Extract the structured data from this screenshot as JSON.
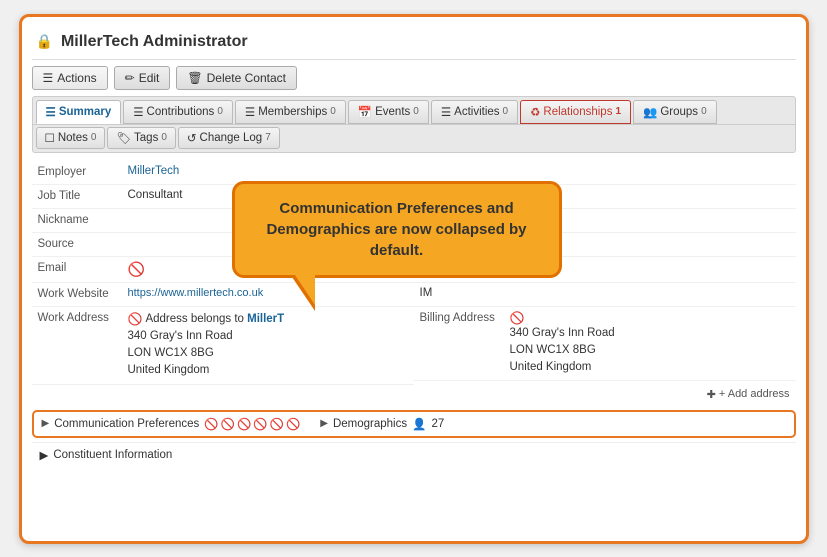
{
  "title": "MillerTech Administrator",
  "toolbar": {
    "actions_label": "Actions",
    "edit_label": "Edit",
    "delete_label": "Delete Contact"
  },
  "tabs_row1": [
    {
      "label": "Summary",
      "badge": "",
      "active": true,
      "icon": "☰"
    },
    {
      "label": "Contributions",
      "badge": "0",
      "active": false,
      "icon": "☰"
    },
    {
      "label": "Memberships",
      "badge": "0",
      "active": false,
      "icon": "☰"
    },
    {
      "label": "Events",
      "badge": "0",
      "active": false,
      "icon": "📅"
    },
    {
      "label": "Activities",
      "badge": "0",
      "active": false,
      "icon": "☰"
    },
    {
      "label": "Relationships",
      "badge": "1",
      "active": false,
      "icon": "♻",
      "highlighted": true
    },
    {
      "label": "Groups",
      "badge": "0",
      "active": false,
      "icon": "👥"
    }
  ],
  "tabs_row2": [
    {
      "label": "Notes",
      "badge": "0",
      "active": false,
      "icon": "☐"
    },
    {
      "label": "Tags",
      "badge": "0",
      "active": false,
      "icon": "🏷"
    },
    {
      "label": "Change Log",
      "badge": "7",
      "active": false,
      "icon": "↺"
    }
  ],
  "fields": {
    "left": [
      {
        "label": "Employer",
        "value": "MillerTech",
        "type": "link"
      },
      {
        "label": "Job Title",
        "value": "Consultant",
        "type": "text"
      },
      {
        "label": "Nickname",
        "value": "",
        "type": "text"
      },
      {
        "label": "Source",
        "value": "",
        "type": "text"
      }
    ],
    "email_label": "Email",
    "work_website_label": "Work Website",
    "work_website_value": "https://www.millertech.co.uk",
    "work_address_label": "Work Address",
    "work_address_value": "Address belongs to MillerTech",
    "work_address_line1": "340 Gray's Inn Road",
    "work_address_line2": "LON WC1X 8BG",
    "work_address_line3": "United Kingdom",
    "billing_address_label": "Billing Address",
    "billing_address_line1": "340 Gray's Inn Road",
    "billing_address_line2": "LON WC1X 8BG",
    "billing_address_line3": "United Kingdom",
    "add_address": "+ Add address"
  },
  "callout": {
    "text": "Communication Preferences and Demographics are now collapsed by default."
  },
  "bottom_strip": {
    "comm_prefs_label": "Communication Preferences",
    "demographics_label": "Demographics",
    "demographics_count": "27"
  },
  "constituent_info_label": "Constituent Information",
  "icons": {
    "lock": "🔒",
    "no": "🚫",
    "pencil": "✏",
    "trash": "🗑",
    "arrow_right": "▶",
    "person": "👤",
    "tag": "🏷",
    "refresh": "↺",
    "calendar": "📅",
    "link": "♻"
  }
}
